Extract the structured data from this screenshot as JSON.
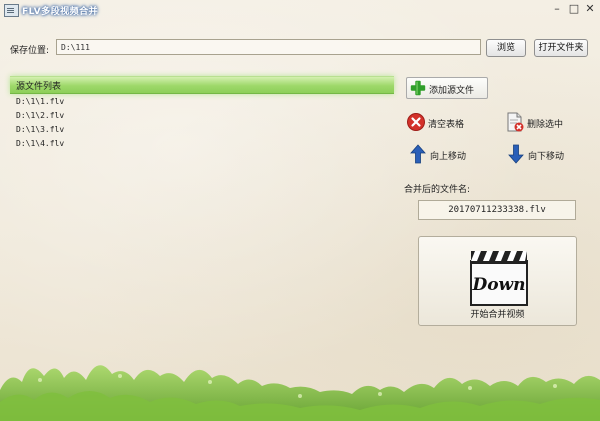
{
  "window": {
    "title": "FLV多段视频合并",
    "controls": {
      "minimize": "–",
      "maximize": "□",
      "close": "✕"
    }
  },
  "save": {
    "label": "保存位置:",
    "path": "D:\\111",
    "browse_label": "浏览",
    "open_folder_label": "打开文件夹"
  },
  "list": {
    "header": "源文件列表",
    "items": [
      "D:\\1\\1.flv",
      "D:\\1\\2.flv",
      "D:\\1\\3.flv",
      "D:\\1\\4.flv"
    ]
  },
  "actions": {
    "add_file": "添加源文件",
    "clear_table": "清空表格",
    "delete_selected": "删除选中",
    "move_up": "向上移动",
    "move_down": "向下移动"
  },
  "merged": {
    "label": "合并后的文件名:",
    "filename": "20170711233338.flv"
  },
  "merge_button": {
    "icon_text": "Down",
    "label": "开始合并视频"
  },
  "colors": {
    "list_header_green": "#9ed86a",
    "add_icon_green": "#2f9e2a",
    "clear_icon_red": "#d3312a",
    "arrow_blue": "#2a5fb8"
  }
}
